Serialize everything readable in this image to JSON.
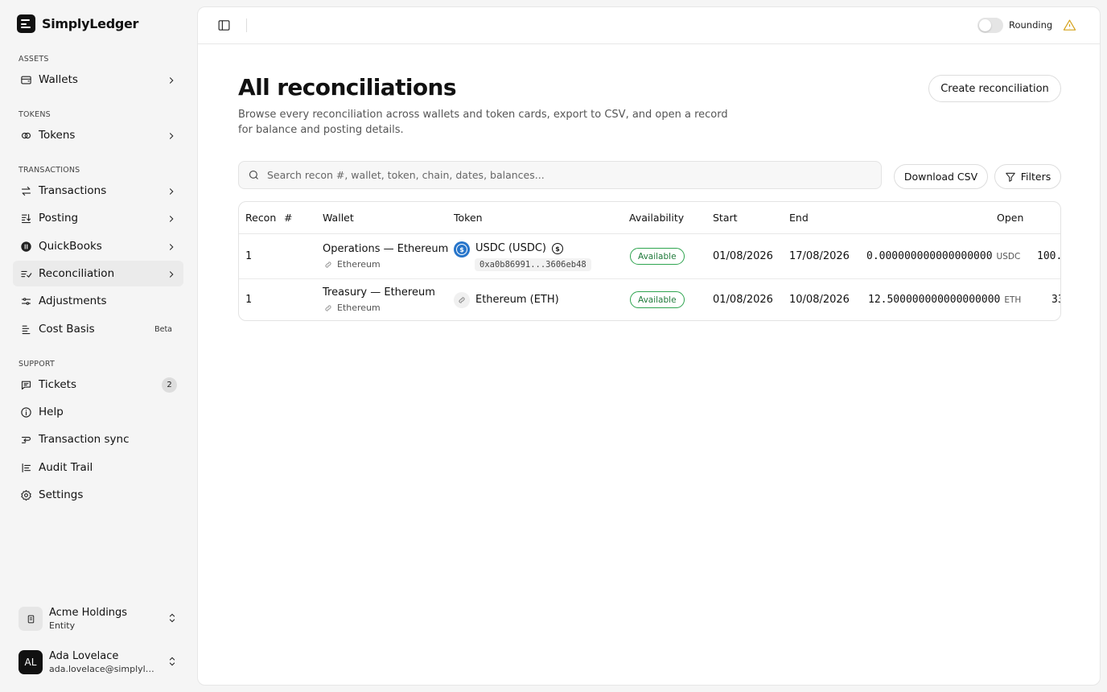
{
  "app": {
    "name": "SimplyLedger"
  },
  "sidebar": {
    "sections": [
      {
        "label": "ASSETS"
      },
      {
        "label": "TOKENS"
      },
      {
        "label": "TRANSACTIONS"
      },
      {
        "label": "SUPPORT"
      }
    ],
    "items": [
      {
        "label": "Wallets",
        "icon": "wallet-icon"
      },
      {
        "label": "Tokens",
        "icon": "tokens-icon"
      },
      {
        "label": "Transactions",
        "icon": "transfer-icon"
      },
      {
        "label": "Posting",
        "icon": "posting-icon"
      },
      {
        "label": "QuickBooks",
        "icon": "quickbooks-icon"
      },
      {
        "label": "Reconciliation",
        "icon": "reconciliation-icon"
      },
      {
        "label": "Adjustments",
        "icon": "sliders-icon"
      },
      {
        "label": "Cost Basis",
        "icon": "cost-basis-icon",
        "badge": "Beta"
      },
      {
        "label": "Tickets",
        "icon": "message-icon",
        "count": "2"
      },
      {
        "label": "Help",
        "icon": "info-icon"
      },
      {
        "label": "Transaction sync",
        "icon": "sync-icon"
      },
      {
        "label": "Audit Trail",
        "icon": "list-icon"
      },
      {
        "label": "Settings",
        "icon": "gear-icon"
      }
    ],
    "entity": {
      "name": "Acme Holdings",
      "type": "Entity"
    },
    "user": {
      "initials": "AL",
      "name": "Ada Lovelace",
      "email": "ada.lovelace@simplyledger.com"
    }
  },
  "topbar": {
    "rounding_label": "Rounding",
    "rounding_on": false
  },
  "page": {
    "title": "All reconciliations",
    "description": "Browse every reconciliation across wallets and token cards, export to CSV, and open a record for balance and posting details.",
    "create_button": "Create reconciliation",
    "search_placeholder": "Search recon #, wallet, token, chain, dates, balances...",
    "download_button": "Download CSV",
    "filters_button": "Filters"
  },
  "table": {
    "columns": [
      "Recon",
      "#",
      "Wallet",
      "Token",
      "Availability",
      "Start",
      "End",
      "Open"
    ],
    "rows": [
      {
        "recon": "1",
        "wallet": "Operations — Ethereum",
        "chain": "Ethereum",
        "token": "USDC (USDC)",
        "address": "0xa0b86991...3606eb48",
        "availability": "Available",
        "start": "01/08/2026",
        "end": "17/08/2026",
        "open": "0.000000000000000000",
        "open_unit": "USDC",
        "next": "100."
      },
      {
        "recon": "1",
        "wallet": "Treasury — Ethereum",
        "chain": "Ethereum",
        "token": "Ethereum (ETH)",
        "availability": "Available",
        "start": "01/08/2026",
        "end": "10/08/2026",
        "open": "12.500000000000000000",
        "open_unit": "ETH",
        "next": "33"
      }
    ]
  },
  "colors": {
    "accent": "#111111",
    "available": "#2ea44f",
    "warning": "#d4a017",
    "usdc": "#2775ca"
  }
}
